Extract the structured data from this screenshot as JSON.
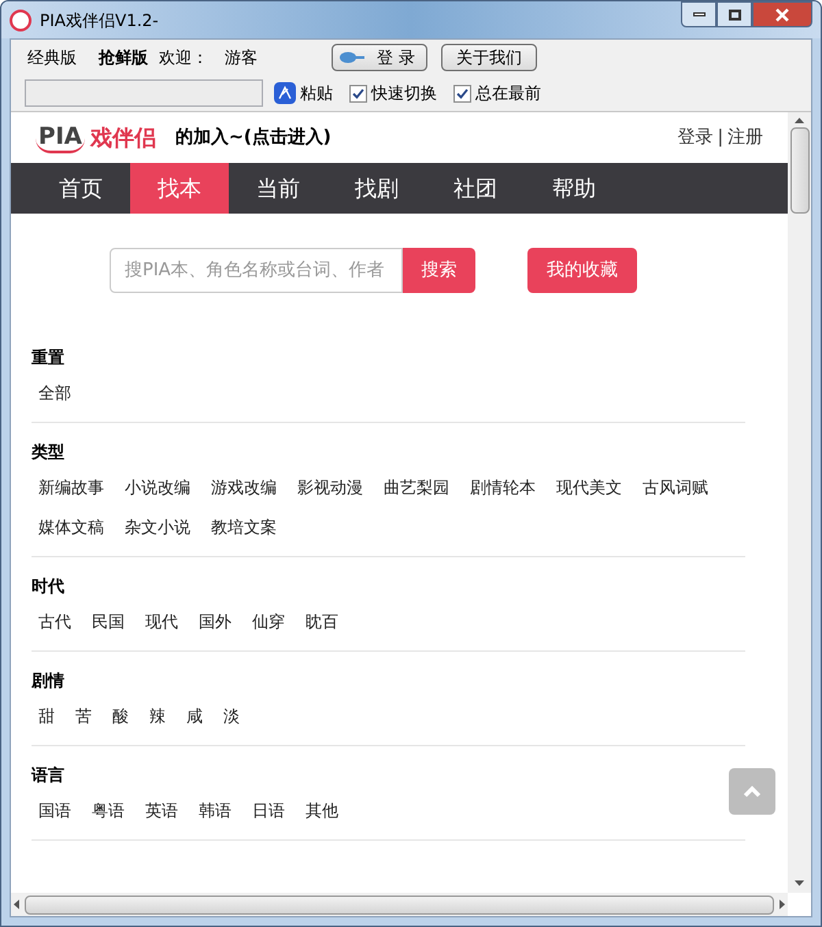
{
  "window": {
    "title": "PIA戏伴侣V1.2-"
  },
  "toolbar": {
    "items": [
      {
        "label": "经典版",
        "selected": false
      },
      {
        "label": "抢鲜版",
        "selected": true
      }
    ],
    "welcome_label": "欢迎：",
    "user": "游客",
    "login_button": "登 录",
    "about_button": "关于我们"
  },
  "options": [
    {
      "label": "粘贴",
      "checked": true,
      "kind": "icon"
    },
    {
      "label": "快速切换",
      "checked": true,
      "kind": "checkbox"
    },
    {
      "label": "总在最前",
      "checked": true,
      "kind": "checkbox"
    }
  ],
  "page": {
    "logo": {
      "latin": "PIA",
      "name": "戏伴侣"
    },
    "marquee": "的加入~(点击进入)",
    "login_link": "登录",
    "separator": "|",
    "register_link": "注册",
    "nav": [
      {
        "label": "首页",
        "selected": false
      },
      {
        "label": "找本",
        "selected": true
      },
      {
        "label": "当前",
        "selected": false
      },
      {
        "label": "找剧",
        "selected": false
      },
      {
        "label": "社团",
        "selected": false
      },
      {
        "label": "帮助",
        "selected": false
      }
    ],
    "search": {
      "placeholder": "搜PIA本、角色名称或台词、作者",
      "button": "搜索"
    },
    "favorites_button": "我的收藏",
    "filters": [
      {
        "title": "重置",
        "options": [
          "全部"
        ]
      },
      {
        "title": "类型",
        "options": [
          "新编故事",
          "小说改编",
          "游戏改编",
          "影视动漫",
          "曲艺梨园",
          "剧情轮本",
          "现代美文",
          "古风词赋",
          "媒体文稿",
          "杂文小说",
          "教培文案"
        ]
      },
      {
        "title": "时代",
        "options": [
          "古代",
          "民国",
          "现代",
          "国外",
          "仙穿",
          "眈百"
        ]
      },
      {
        "title": "剧情",
        "options": [
          "甜",
          "苦",
          "酸",
          "辣",
          "咸",
          "淡"
        ]
      },
      {
        "title": "语言",
        "options": [
          "国语",
          "粤语",
          "英语",
          "韩语",
          "日语",
          "其他"
        ]
      }
    ]
  }
}
